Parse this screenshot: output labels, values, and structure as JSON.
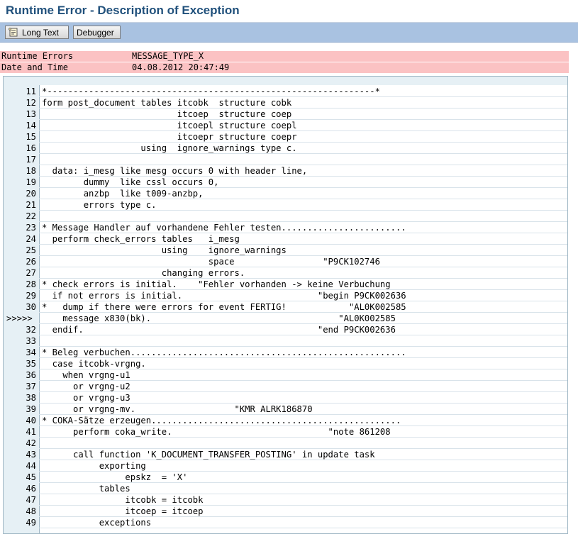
{
  "window": {
    "title": "Runtime Error - Description of Exception"
  },
  "toolbar": {
    "long_text_label": "Long Text",
    "debugger_label": "Debugger"
  },
  "info": {
    "runtime_errors_label": "Runtime Errors",
    "runtime_errors_value": "MESSAGE_TYPE_X",
    "date_time_label": "Date and Time",
    "date_time_value": "04.08.2012 20:47:49"
  },
  "code": {
    "lines": [
      {
        "num": "11",
        "text": "*---------------------------------------------------------------*"
      },
      {
        "num": "12",
        "text": "form post_document tables itcobk  structure cobk"
      },
      {
        "num": "13",
        "text": "                          itcoep  structure coep"
      },
      {
        "num": "14",
        "text": "                          itcoepl structure coepl"
      },
      {
        "num": "15",
        "text": "                          itcoepr structure coepr"
      },
      {
        "num": "16",
        "text": "                   using  ignore_warnings type c."
      },
      {
        "num": "17",
        "text": ""
      },
      {
        "num": "18",
        "text": "  data: i_mesg like mesg occurs 0 with header line,"
      },
      {
        "num": "19",
        "text": "        dummy  like cssl occurs 0,"
      },
      {
        "num": "20",
        "text": "        anzbp  like t009-anzbp,"
      },
      {
        "num": "21",
        "text": "        errors type c."
      },
      {
        "num": "22",
        "text": ""
      },
      {
        "num": "23",
        "text": "* Message Handler auf vorhandene Fehler testen........................"
      },
      {
        "num": "24",
        "text": "  perform check_errors tables   i_mesg"
      },
      {
        "num": "25",
        "text": "                       using    ignore_warnings"
      },
      {
        "num": "26",
        "text": "                                space                 \"P9CK102746"
      },
      {
        "num": "27",
        "text": "                       changing errors."
      },
      {
        "num": "28",
        "text": "* check errors is initial.    \"Fehler vorhanden -> keine Verbuchung"
      },
      {
        "num": "29",
        "text": "  if not errors is initial.                          \"begin P9CK002636"
      },
      {
        "num": "30",
        "text": "*   dump if there were errors for event FERTIG!            \"AL0K002585"
      },
      {
        "num": "31",
        "text": "    message x830(bk).                                    \"AL0K002585",
        "marker": ">>>>>"
      },
      {
        "num": "32",
        "text": "  endif.                                             \"end P9CK002636"
      },
      {
        "num": "33",
        "text": ""
      },
      {
        "num": "34",
        "text": "* Beleg verbuchen....................................................."
      },
      {
        "num": "35",
        "text": "  case itcobk-vrgng."
      },
      {
        "num": "36",
        "text": "    when vrgng-u1"
      },
      {
        "num": "37",
        "text": "      or vrgng-u2"
      },
      {
        "num": "38",
        "text": "      or vrgng-u3"
      },
      {
        "num": "39",
        "text": "      or vrgng-mv.                   \"KMR ALRK186870"
      },
      {
        "num": "40",
        "text": "* COKA-Sätze erzeugen................................................"
      },
      {
        "num": "41",
        "text": "      perform coka_write.                              \"note 861208"
      },
      {
        "num": "42",
        "text": ""
      },
      {
        "num": "43",
        "text": "      call function 'K_DOCUMENT_TRANSFER_POSTING' in update task"
      },
      {
        "num": "44",
        "text": "           exporting"
      },
      {
        "num": "45",
        "text": "                epskz  = 'X'"
      },
      {
        "num": "46",
        "text": "           tables"
      },
      {
        "num": "47",
        "text": "                itcobk = itcobk"
      },
      {
        "num": "48",
        "text": "                itcoep = itcoep"
      },
      {
        "num": "49",
        "text": "           exceptions"
      }
    ]
  },
  "colors": {
    "title": "#21517c",
    "toolbar_bg": "#a9c2e1",
    "info_bg": "#fbc2c3",
    "code_gutter_bg": "#e6f0f5"
  },
  "icons": {
    "long_text": "document-scroll-icon"
  }
}
